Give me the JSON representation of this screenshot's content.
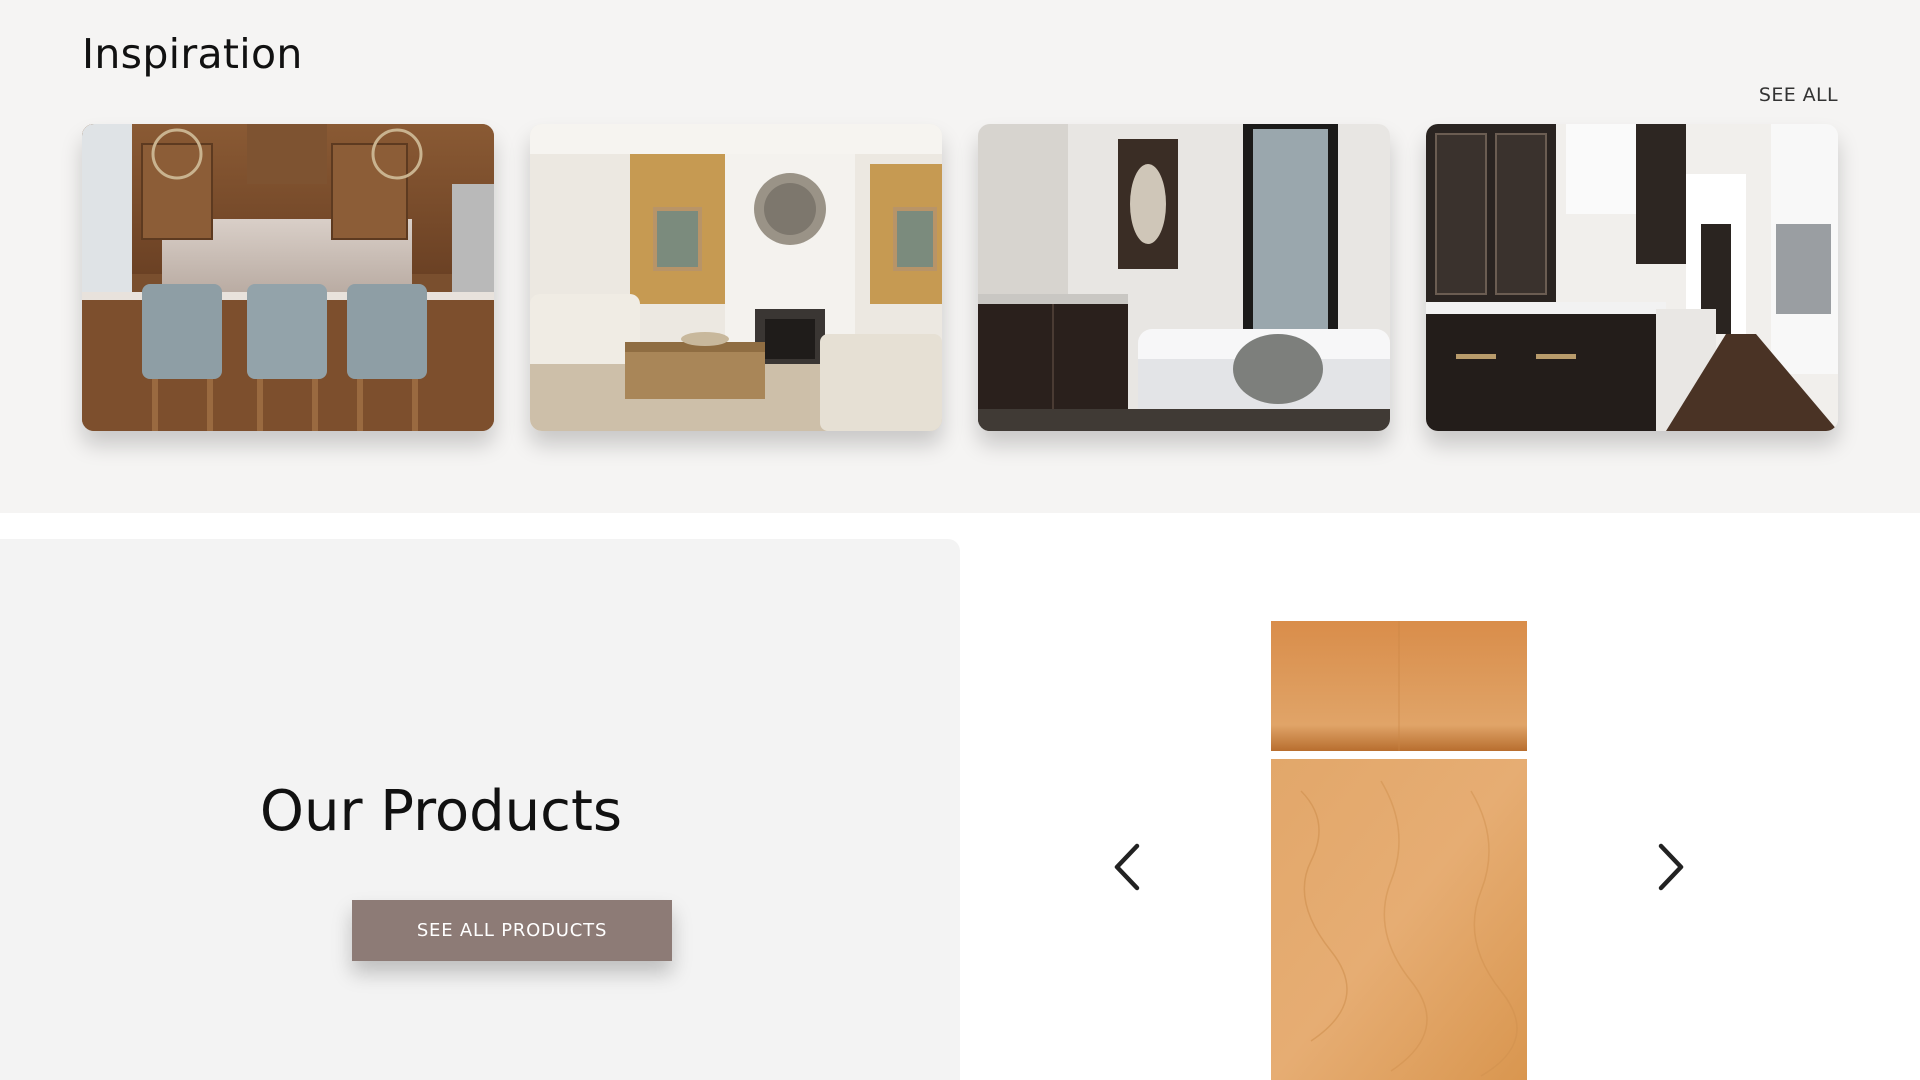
{
  "inspiration": {
    "title": "Inspiration",
    "see_all_label": "SEE ALL",
    "cards": [
      {
        "subject": "kitchen-walnut-island"
      },
      {
        "subject": "living-room-fireplace"
      },
      {
        "subject": "bathroom-dark-vanity"
      },
      {
        "subject": "kitchen-dark-cabinets-hallway"
      }
    ]
  },
  "products": {
    "title": "Our Products",
    "button_label": "SEE ALL PRODUCTS",
    "button_color": "#8d7b76",
    "panel_color": "#f3f3f3"
  },
  "carousel": {
    "prev_icon": "chevron-left-icon",
    "next_icon": "chevron-right-icon",
    "item": "maple-cabinet-door"
  },
  "colors": {
    "inspiration_bg": "#f5f4f3",
    "text": "#111111",
    "wood": "#d9944f"
  }
}
